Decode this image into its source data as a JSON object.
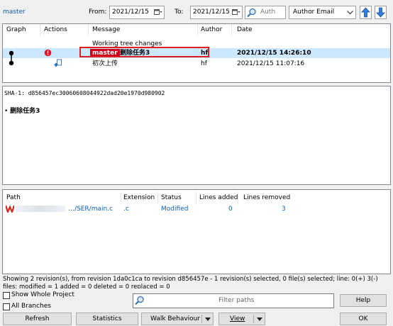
{
  "toolbar": {
    "branch": "master",
    "from_label": "From:",
    "from_value": "2021/12/15",
    "to_label": "To:",
    "to_value": "2021/12/15",
    "search_placeholder": "Auth",
    "filter_mode": "Author Email"
  },
  "log": {
    "columns": [
      "Graph",
      "Actions",
      "Message",
      "Author",
      "Date"
    ],
    "working_tree": "Working tree changes",
    "rows": [
      {
        "tag": "master",
        "message": "删除任务3",
        "author": "hf",
        "date": "2021/12/15 14:26:10"
      },
      {
        "message": "初次上传",
        "author": "hf",
        "date": "2021/12/15 11:07:16"
      }
    ]
  },
  "detail": {
    "sha": "SHA-1: d856457ec30060608044922dad20e1970d980902",
    "message": "删除任务3"
  },
  "files": {
    "columns": [
      "Path",
      "Extension",
      "Status",
      "Lines added",
      "Lines removed"
    ],
    "rows": [
      {
        "path": "…/SER/main.c",
        "ext": ".c",
        "status": "Modified",
        "added": "0",
        "removed": "3"
      }
    ]
  },
  "status_text": "Showing 2 revision(s), from revision 1da0c1ca to revision d856457e - 1 revision(s) selected, 0 file(s) selected; line: 0(+) 3(-) files: modified = 1 added = 0 deleted = 0 replaced = 0",
  "bottom": {
    "show_whole_project": "Show Whole Project",
    "all_branches": "All Branches",
    "filter_paths_placeholder": "Filter paths",
    "help": "Help",
    "refresh": "Refresh",
    "statistics": "Statistics",
    "walk_behaviour": "Walk Behaviour",
    "view": "View",
    "ok": "OK"
  },
  "colors": {
    "selection": "#cce8ff",
    "branch_tag": "#d0021b",
    "annotation": "#e02020",
    "link": "#0b5dba"
  }
}
